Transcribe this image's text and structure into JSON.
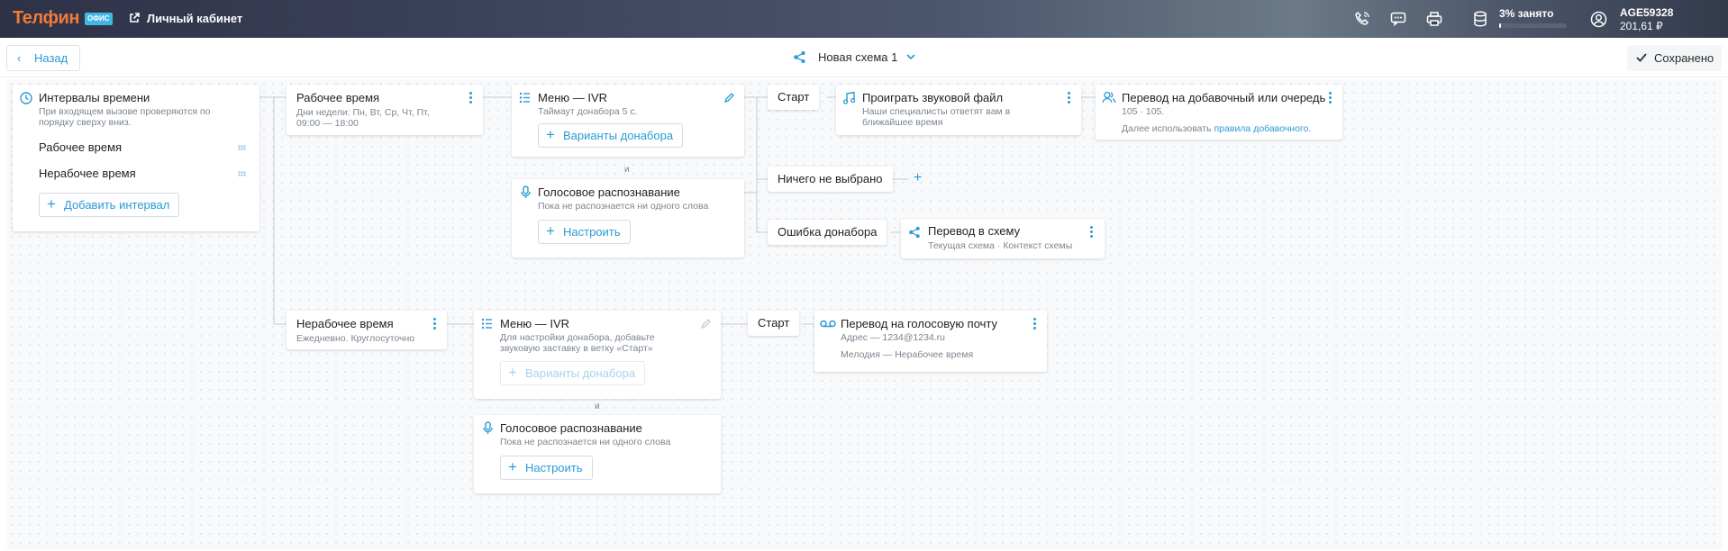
{
  "topbar": {
    "logo": "Телфин",
    "logo_badge": "ОФИС",
    "cabinet_link": "Личный кабинет",
    "disk_status": "3% занято",
    "disk_used_fraction": 0.03,
    "account_id": "AGE59328",
    "balance": "201,61 ₽",
    "icons": [
      "external-link-icon",
      "phone-icon",
      "chat-icon",
      "printer-icon",
      "storage-icon",
      "user-icon"
    ]
  },
  "header": {
    "back_label": "Назад",
    "scheme_name": "Новая схема 1",
    "saved_label": "Сохранено"
  },
  "intervals": {
    "title": "Интервалы времени",
    "subtitle": "При входящем вызове проверяются по порядку сверху вниз.",
    "items": [
      "Рабочее время",
      "Нерабочее время"
    ],
    "add_label": "Добавить интервал"
  },
  "work": {
    "title": "Рабочее время",
    "subtitle": "Дни недели: Пн, Вт, Ср, Чт, Пт, 09:00 — 18:00",
    "menu": {
      "title": "Меню — IVR",
      "subtitle": "Таймаут донабора 5 с.",
      "button": "Варианты донабора"
    },
    "and_label": "и",
    "voice": {
      "title": "Голосовое распознавание",
      "subtitle": "Пока не распознается ни одного слова",
      "button": "Настроить"
    },
    "branches": {
      "start": "Старт",
      "none": "Ничего не выбрано",
      "error": "Ошибка донабора"
    },
    "play": {
      "title": "Проиграть звуковой файл",
      "subtitle": "Наши специалисты ответят вам в ближайшее время"
    },
    "transfer": {
      "title": "Перевод на добавочный или очередь",
      "subtitle": "105 · 105.",
      "note_prefix": "Далее использовать",
      "note_link": "правила добавочного."
    },
    "scheme": {
      "title": "Перевод в схему",
      "subtitle": "Текущая схема · Контекст схемы"
    }
  },
  "nonwork": {
    "title": "Нерабочее время",
    "subtitle": "Ежедневно. Круглосуточно",
    "menu": {
      "title": "Меню — IVR",
      "subtitle": "Для настройки донабора, добавьте звуковую заставку в ветку «Старт»",
      "button": "Варианты донабора"
    },
    "and_label": "и",
    "voice": {
      "title": "Голосовое распознавание",
      "subtitle": "Пока не распознается ни одного слова",
      "button": "Настроить"
    },
    "start": "Старт",
    "voicemail": {
      "title": "Перевод на голосовую почту",
      "address": "Адрес — 1234@1234.ru",
      "melody": "Мелодия — Нерабочее время"
    }
  }
}
